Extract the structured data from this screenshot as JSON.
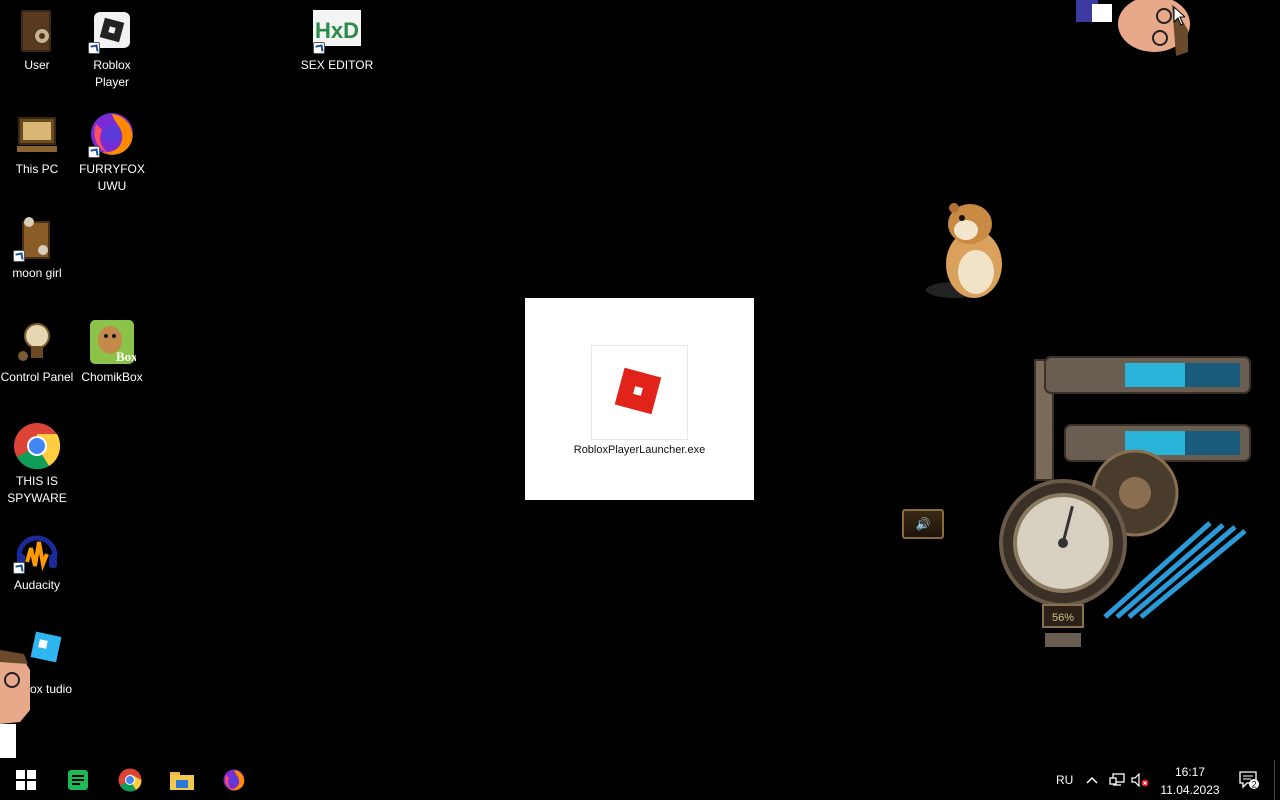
{
  "desktop": {
    "icons": [
      {
        "name": "user",
        "label": "User",
        "icon": "user-folder-icon"
      },
      {
        "name": "roblox-player",
        "label": "Roblox Player",
        "icon": "roblox-icon"
      },
      {
        "name": "sex-editor",
        "label": "SEX EDITOR",
        "icon": "hxd-editor-icon"
      },
      {
        "name": "this-pc",
        "label": "This PC",
        "icon": "computer-icon"
      },
      {
        "name": "furryfox-uwu",
        "label": "FURRYFOX UWU",
        "icon": "firefox-icon"
      },
      {
        "name": "moon-girl",
        "label": "moon girl",
        "icon": "folder-icon"
      },
      {
        "name": "control-panel",
        "label": "Control Panel",
        "icon": "control-panel-icon"
      },
      {
        "name": "chomikbox",
        "label": "ChomikBox",
        "icon": "chomikbox-icon"
      },
      {
        "name": "this-is-spyware",
        "label": "THIS IS SPYWARE",
        "icon": "chrome-icon"
      },
      {
        "name": "audacity",
        "label": "Audacity",
        "icon": "audacity-icon"
      },
      {
        "name": "roblox-studio",
        "label": "oblox tudio",
        "icon": "roblox-studio-icon"
      }
    ],
    "chomikbox_badge": "Box",
    "hxd_badge": "HxD"
  },
  "launcher": {
    "filename": "RobloxPlayerLauncher.exe",
    "icon": "roblox-logo-icon"
  },
  "gadget": {
    "gauge_reading": "56%",
    "gauge_level": 0.56
  },
  "taskbar": {
    "items": [
      {
        "name": "start-button",
        "icon": "windows-logo-icon"
      },
      {
        "name": "taskbar-app-green",
        "icon": "green-app-icon"
      },
      {
        "name": "taskbar-chrome",
        "icon": "chrome-icon"
      },
      {
        "name": "taskbar-explorer",
        "icon": "file-explorer-icon"
      },
      {
        "name": "taskbar-firefox",
        "icon": "firefox-icon"
      }
    ],
    "tray": {
      "language": "RU",
      "time": "16:17",
      "date": "11.04.2023",
      "notification_count": "2"
    }
  },
  "colors": {
    "desktop_bg": "#000000",
    "roblox_red": "#e2231a"
  }
}
